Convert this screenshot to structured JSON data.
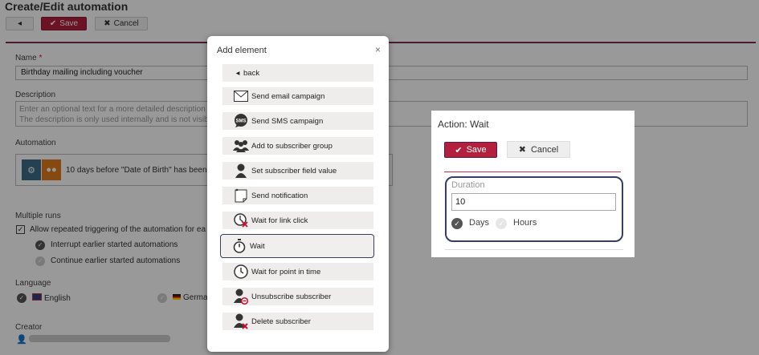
{
  "page": {
    "title": "Create/Edit automation",
    "toolbar": {
      "back_icon": "caret-left-icon",
      "save_label": "Save",
      "cancel_label": "Cancel"
    },
    "name": {
      "label": "Name",
      "required_mark": "*",
      "value": "Birthday mailing including voucher"
    },
    "description": {
      "label": "Description",
      "placeholder_line1": "Enter an optional text for a more detailed description",
      "placeholder_line2": "The description is only used internally and is not visib"
    },
    "automation": {
      "label": "Automation",
      "trigger_text": "10 days before \"Date of Birth\" has been"
    },
    "multiple_runs": {
      "label": "Multiple runs",
      "allow_label": "Allow repeated triggering of the automation for ea",
      "interrupt_label": "Interrupt earlier started automations",
      "continue_label": "Continue earlier started automations"
    },
    "language": {
      "label": "Language",
      "english": "English",
      "german": "Germa"
    },
    "creator": {
      "label": "Creator"
    }
  },
  "modal": {
    "title": "Add element",
    "close": "×",
    "items": [
      {
        "label": "back",
        "icon": "caret-left-icon"
      },
      {
        "label": "Send email campaign",
        "icon": "envelope-icon"
      },
      {
        "label": "Send SMS campaign",
        "icon": "sms-icon"
      },
      {
        "label": "Add to subscriber group",
        "icon": "group-icon"
      },
      {
        "label": "Set subscriber field value",
        "icon": "user-icon"
      },
      {
        "label": "Send notification",
        "icon": "note-icon"
      },
      {
        "label": "Wait for link click",
        "icon": "clock-link-icon"
      },
      {
        "label": "Wait",
        "icon": "stopwatch-icon"
      },
      {
        "label": "Wait for point in time",
        "icon": "clock-icon"
      },
      {
        "label": "Unsubscribe subscriber",
        "icon": "user-unsubscribe-icon"
      },
      {
        "label": "Delete subscriber",
        "icon": "user-delete-icon"
      }
    ]
  },
  "action_panel": {
    "title": "Action: Wait",
    "save_label": "Save",
    "cancel_label": "Cancel",
    "duration_label": "Duration",
    "duration_value": "10",
    "unit_days": "Days",
    "unit_hours": "Hours",
    "selected_unit": "Days"
  },
  "colors": {
    "brand_red": "#b2203e",
    "highlight_border": "#3a3e5e"
  }
}
